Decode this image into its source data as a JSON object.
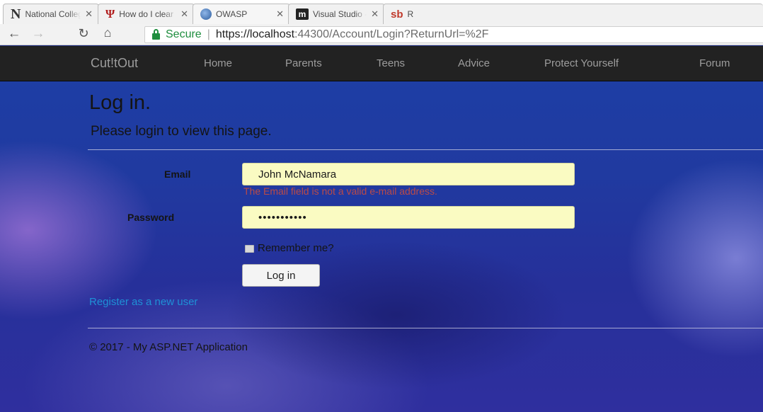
{
  "browser": {
    "tabs": [
      {
        "title": "National College",
        "icon": "n-logo-icon",
        "close": "✕"
      },
      {
        "title": "How do I clear m",
        "icon": "psi-logo-icon",
        "close": "✕"
      },
      {
        "title": "OWASP",
        "icon": "owasp-logo-icon",
        "close": "✕"
      },
      {
        "title": "Visual Studio - I",
        "icon": "m-logo-icon",
        "close": "✕"
      },
      {
        "title": "R",
        "icon": "sb-logo-icon",
        "close": ""
      }
    ],
    "secure_label": "Secure",
    "url_host": "https://localhost",
    "url_rest": ":44300/Account/Login?ReturnUrl=%2F"
  },
  "navbar": {
    "brand": "Cut!tOut",
    "links": [
      "Home",
      "Parents",
      "Teens",
      "Advice",
      "Protect Yourself",
      "Forum"
    ]
  },
  "login": {
    "title": "Log in.",
    "subtitle": "Please login to view this page.",
    "email_label": "Email",
    "email_value": "John McNamara",
    "email_error": "The Email field is not a valid e-mail address.",
    "password_label": "Password",
    "password_value": "•••••••••••",
    "remember_label": "Remember me?",
    "remember_checked": false,
    "submit_label": "Log in",
    "register_link": "Register as a new user"
  },
  "footer": {
    "text": "© 2017 - My ASP.NET Application"
  },
  "colors": {
    "navbar": "#222222",
    "nav_text": "#9d9d9d",
    "input_autofill": "#fafbc2",
    "error": "#b94a48",
    "link": "#1f91d6",
    "secure": "#1e8e3e"
  }
}
